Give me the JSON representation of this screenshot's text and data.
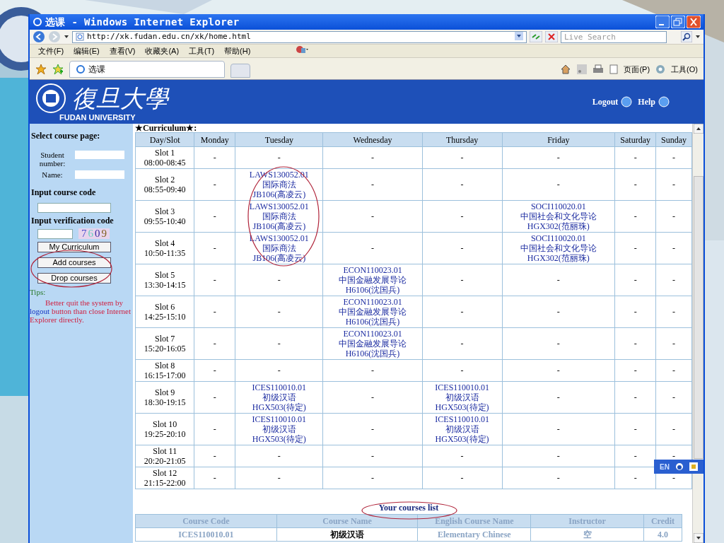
{
  "window": {
    "title": "选课 - Windows Internet Explorer"
  },
  "address_bar": {
    "url": "http://xk.fudan.edu.cn/xk/home.html"
  },
  "search": {
    "placeholder": "Live Search"
  },
  "menu": [
    "文件(F)",
    "编辑(E)",
    "查看(V)",
    "收藏夹(A)",
    "工具(T)",
    "帮助(H)"
  ],
  "tab": {
    "label": "选课"
  },
  "command_bar": [
    "页面(P)",
    "工具(O)"
  ],
  "header": {
    "logo_text": "復旦大學",
    "logo_subtitle": "FUDAN UNIVERSITY",
    "links": [
      "Logout",
      "Help"
    ]
  },
  "sidebar": {
    "title": "Select course page:",
    "fields": [
      {
        "label": "Student number:"
      },
      {
        "label": "Name:"
      }
    ],
    "course_code_label": "Input course code",
    "verification_label": "Input verification code",
    "captcha": "7609",
    "buttons": [
      "My Curriculum",
      "Add courses",
      "Drop courses"
    ],
    "tips_label": "Tips:",
    "tips_before": "Better quit the system by ",
    "tips_link": "logout",
    "tips_after": " button than close Internet Explorer directly."
  },
  "curriculum": {
    "title": "★Curriculum★:",
    "columns": [
      "Day/Slot",
      "Monday",
      "Tuesday",
      "Wednesday",
      "Thursday",
      "Friday",
      "Saturday",
      "Sunday"
    ],
    "rows": [
      [
        [
          "Slot 1",
          "08:00-08:45"
        ],
        [
          "-"
        ],
        [
          "-"
        ],
        [
          "-"
        ],
        [
          "-"
        ],
        [
          "-"
        ],
        [
          "-"
        ],
        [
          "-"
        ]
      ],
      [
        [
          "Slot 2",
          "08:55-09:40"
        ],
        [
          "-"
        ],
        [
          "LAWS130052.01",
          "国际商法",
          "JB106(高凌云)"
        ],
        [
          "-"
        ],
        [
          "-"
        ],
        [
          "-"
        ],
        [
          "-"
        ],
        [
          "-"
        ]
      ],
      [
        [
          "Slot 3",
          "09:55-10:40"
        ],
        [
          "-"
        ],
        [
          "LAWS130052.01",
          "国际商法",
          "JB106(高凌云)"
        ],
        [
          "-"
        ],
        [
          "-"
        ],
        [
          "SOCI110020.01",
          "中国社会和文化导论",
          "HGX302(范丽珠)"
        ],
        [
          "-"
        ],
        [
          "-"
        ]
      ],
      [
        [
          "Slot 4",
          "10:50-11:35"
        ],
        [
          "-"
        ],
        [
          "LAWS130052.01",
          "国际商法",
          "JB106(高凌云)"
        ],
        [
          "-"
        ],
        [
          "-"
        ],
        [
          "SOCI110020.01",
          "中国社会和文化导论",
          "HGX302(范丽珠)"
        ],
        [
          "-"
        ],
        [
          "-"
        ]
      ],
      [
        [
          "Slot 5",
          "13:30-14:15"
        ],
        [
          "-"
        ],
        [
          "-"
        ],
        [
          "ECON110023.01",
          "中国金融发展导论",
          "H6106(沈国兵)"
        ],
        [
          "-"
        ],
        [
          "-"
        ],
        [
          "-"
        ],
        [
          "-"
        ]
      ],
      [
        [
          "Slot 6",
          "14:25-15:10"
        ],
        [
          "-"
        ],
        [
          "-"
        ],
        [
          "ECON110023.01",
          "中国金融发展导论",
          "H6106(沈国兵)"
        ],
        [
          "-"
        ],
        [
          "-"
        ],
        [
          "-"
        ],
        [
          "-"
        ]
      ],
      [
        [
          "Slot 7",
          "15:20-16:05"
        ],
        [
          "-"
        ],
        [
          "-"
        ],
        [
          "ECON110023.01",
          "中国金融发展导论",
          "H6106(沈国兵)"
        ],
        [
          "-"
        ],
        [
          "-"
        ],
        [
          "-"
        ],
        [
          "-"
        ]
      ],
      [
        [
          "Slot 8",
          "16:15-17:00"
        ],
        [
          "-"
        ],
        [
          "-"
        ],
        [
          "-"
        ],
        [
          "-"
        ],
        [
          "-"
        ],
        [
          "-"
        ],
        [
          "-"
        ]
      ],
      [
        [
          "Slot 9",
          "18:30-19:15"
        ],
        [
          "-"
        ],
        [
          "ICES110010.01",
          "初级汉语",
          "HGX503(待定)"
        ],
        [
          "-"
        ],
        [
          "ICES110010.01",
          "初级汉语",
          "HGX503(待定)"
        ],
        [
          "-"
        ],
        [
          "-"
        ],
        [
          "-"
        ]
      ],
      [
        [
          "Slot 10",
          "19:25-20:10"
        ],
        [
          "-"
        ],
        [
          "ICES110010.01",
          "初级汉语",
          "HGX503(待定)"
        ],
        [
          "-"
        ],
        [
          "ICES110010.01",
          "初级汉语",
          "HGX503(待定)"
        ],
        [
          "-"
        ],
        [
          "-"
        ],
        [
          "-"
        ]
      ],
      [
        [
          "Slot 11",
          "20:20-21:05"
        ],
        [
          "-"
        ],
        [
          "-"
        ],
        [
          "-"
        ],
        [
          "-"
        ],
        [
          "-"
        ],
        [
          "-"
        ],
        [
          "-"
        ]
      ],
      [
        [
          "Slot 12",
          "21:15-22:00"
        ],
        [
          "-"
        ],
        [
          "-"
        ],
        [
          "-"
        ],
        [
          "-"
        ],
        [
          "-"
        ],
        [
          "-"
        ],
        [
          "-"
        ]
      ]
    ]
  },
  "courses_list": {
    "title": "Your courses list",
    "columns": [
      "Course Code",
      "Course Name",
      "English Course Name",
      "Instructor",
      "Credit"
    ],
    "rows": [
      [
        "ICES110010.01",
        "初级汉语",
        "Elementary Chinese",
        "空",
        "4.0"
      ]
    ]
  },
  "language_bar": {
    "label": "EN"
  }
}
